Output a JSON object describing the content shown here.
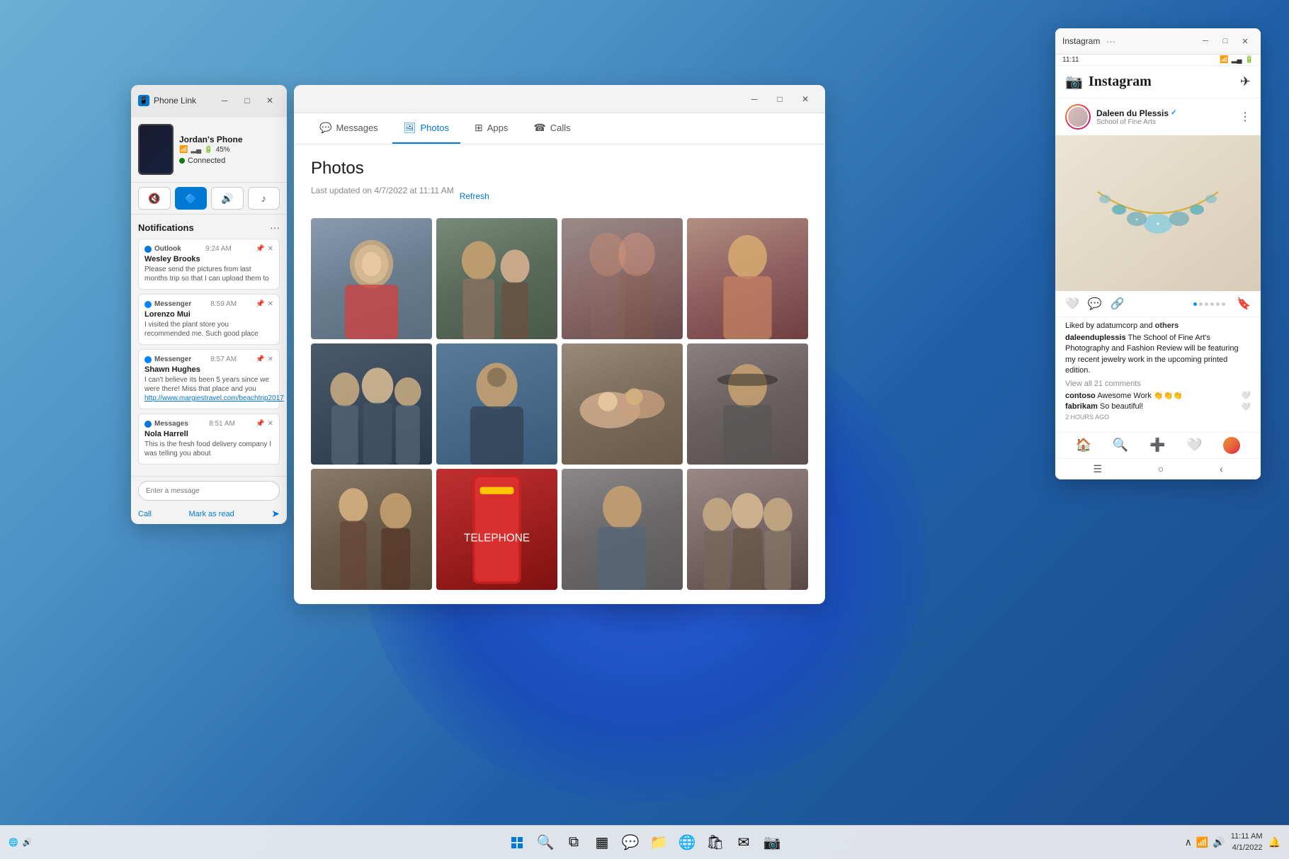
{
  "desktop": {
    "wallpaper_desc": "Windows 11 blue bloom wallpaper"
  },
  "taskbar": {
    "time": "11:11 AM",
    "date": "4/1/2022",
    "icons": [
      {
        "name": "start-icon",
        "label": "Start",
        "symbol": "⊞"
      },
      {
        "name": "search-icon",
        "label": "Search",
        "symbol": "⌕"
      },
      {
        "name": "task-view-icon",
        "label": "Task View",
        "symbol": "❑"
      },
      {
        "name": "widgets-icon",
        "label": "Widgets",
        "symbol": "⊟"
      },
      {
        "name": "chat-icon",
        "label": "Chat",
        "symbol": "💬"
      },
      {
        "name": "explorer-icon",
        "label": "File Explorer",
        "symbol": "📁"
      },
      {
        "name": "edge-icon",
        "label": "Microsoft Edge",
        "symbol": "🌐"
      },
      {
        "name": "store-icon",
        "label": "Microsoft Store",
        "symbol": "🛍"
      },
      {
        "name": "mail-icon",
        "label": "Mail",
        "symbol": "✉"
      },
      {
        "name": "instagram-taskbar-icon",
        "label": "Instagram",
        "symbol": "📷"
      }
    ]
  },
  "phone_link": {
    "title": "Phone Link",
    "phone_name": "Jordan's Phone",
    "battery_percent": "45%",
    "signal_bars": "▂▄▆",
    "wifi_icon": "📶",
    "bluetooth_active": true,
    "connected_text": "Connected",
    "action_buttons": [
      {
        "id": "mute",
        "symbol": "🔇",
        "active": false
      },
      {
        "id": "bluetooth",
        "symbol": "🔷",
        "active": true
      },
      {
        "id": "volume",
        "symbol": "🔊",
        "active": false
      },
      {
        "id": "music",
        "symbol": "♪",
        "active": false
      }
    ],
    "notifications_title": "Notifications",
    "notifications": [
      {
        "app": "Outlook",
        "app_color": "#0078d4",
        "time": "9:24 AM",
        "sender": "Wesley Brooks",
        "text": "Please send the pictures from last months trip so that I can upload them to"
      },
      {
        "app": "Messenger",
        "app_color": "#0084ff",
        "time": "8:59 AM",
        "sender": "Lorenzo Mui",
        "text": "I visited the plant store you recommended me. Such good place"
      },
      {
        "app": "Messenger",
        "app_color": "#0084ff",
        "time": "8:57 AM",
        "sender": "Shawn Hughes",
        "text": "I can't believe its been 5 years since we were there! Miss that place and you",
        "link_text": "http://www.margiestravel.com/beachtrip2017"
      },
      {
        "app": "Messages",
        "app_color": "#0078d4",
        "time": "8:51 AM",
        "sender": "Nola Harrell",
        "text": "This is the fresh food delivery company I was telling you about"
      }
    ],
    "message_placeholder": "Enter a message",
    "call_label": "Call",
    "mark_as_read_label": "Mark as read"
  },
  "photos_window": {
    "title": "Photos",
    "last_updated": "Last updated on 4/7/2022 at 11:11 AM",
    "refresh_label": "Refresh",
    "tabs": [
      {
        "id": "messages",
        "label": "Messages",
        "icon": "💬"
      },
      {
        "id": "photos",
        "label": "Photos",
        "icon": "🖼",
        "active": true
      },
      {
        "id": "apps",
        "label": "Apps",
        "icon": "⊞"
      },
      {
        "id": "calls",
        "label": "Calls",
        "icon": "☎"
      }
    ],
    "photos": [
      {
        "id": 1,
        "desc": "Young woman smiling in bookstore",
        "gradient": "linear-gradient(160deg, #8a9bb0 0%, #6a7d8f 50%, #5a6d7f 100%)"
      },
      {
        "id": 2,
        "desc": "Two people looking at phone",
        "gradient": "linear-gradient(160deg, #7a8a7a 0%, #5a6a5a 50%, #4a5a4a 100%)"
      },
      {
        "id": 3,
        "desc": "Two women with red hair from behind",
        "gradient": "linear-gradient(160deg, #9a7a7a 0%, #7a5a5a 50%, #5a3a3a 100%)"
      },
      {
        "id": 4,
        "desc": "Woman smiling outdoors",
        "gradient": "linear-gradient(160deg, #b09080 0%, #906060 50%, #704040 100%)"
      },
      {
        "id": 5,
        "desc": "Group of people studying",
        "gradient": "linear-gradient(160deg, #5a6a7a 0%, #4a5a6a 50%, #3a4a5a 100%)"
      },
      {
        "id": 6,
        "desc": "Young man with glasses smiling",
        "gradient": "linear-gradient(160deg, #6a7a8a 0%, #5a6a7a 50%, #4a5a6a 100%)"
      },
      {
        "id": 7,
        "desc": "Hands close up",
        "gradient": "linear-gradient(160deg, #9a8a7a 0%, #7a6a5a 50%, #6a5a4a 100%)"
      },
      {
        "id": 8,
        "desc": "Person with headphones",
        "gradient": "linear-gradient(160deg, #9a9090 0%, #7a7070 50%, #6a6060 100%)"
      },
      {
        "id": 9,
        "desc": "Street scene people",
        "gradient": "linear-gradient(160deg, #8a7a6a 0%, #6a5a4a 50%, #5a4a3a 100%)"
      },
      {
        "id": 10,
        "desc": "Red telephone box London",
        "gradient": "linear-gradient(160deg, #c03030 0%, #a02020 50%, #801010 100%)"
      },
      {
        "id": 11,
        "desc": "Young man outdoors",
        "gradient": "linear-gradient(160deg, #8a9090 0%, #6a7070 50%, #5a6060 100%)"
      },
      {
        "id": 12,
        "desc": "Group of friends outdoors",
        "gradient": "linear-gradient(160deg, #9a8080 0%, #7a6060 50%, #6a5050 100%)"
      }
    ]
  },
  "instagram": {
    "app_title": "Instagram",
    "status_time": "11:11",
    "username": "Daleen du Plessis",
    "user_handle": "daleenduplessis",
    "user_subtitle": "School of Fine Arts",
    "verified": true,
    "logo_text": "Instagram",
    "likes_text": "Liked by adatumcorp and",
    "likes_others": "others",
    "caption_user": "daleenduplessis",
    "caption_text": " The School of Fine Art's Photography and Fashion Review will be featuring my recent jewelry work in the upcoming printed edition.",
    "view_comments": "View all 21 comments",
    "comments": [
      {
        "user": "contoso",
        "text": " Awesome Work 👏👏👏"
      },
      {
        "user": "fabrikam",
        "text": " So beautiful!"
      }
    ],
    "time_ago": "2 HOURS AGO"
  }
}
